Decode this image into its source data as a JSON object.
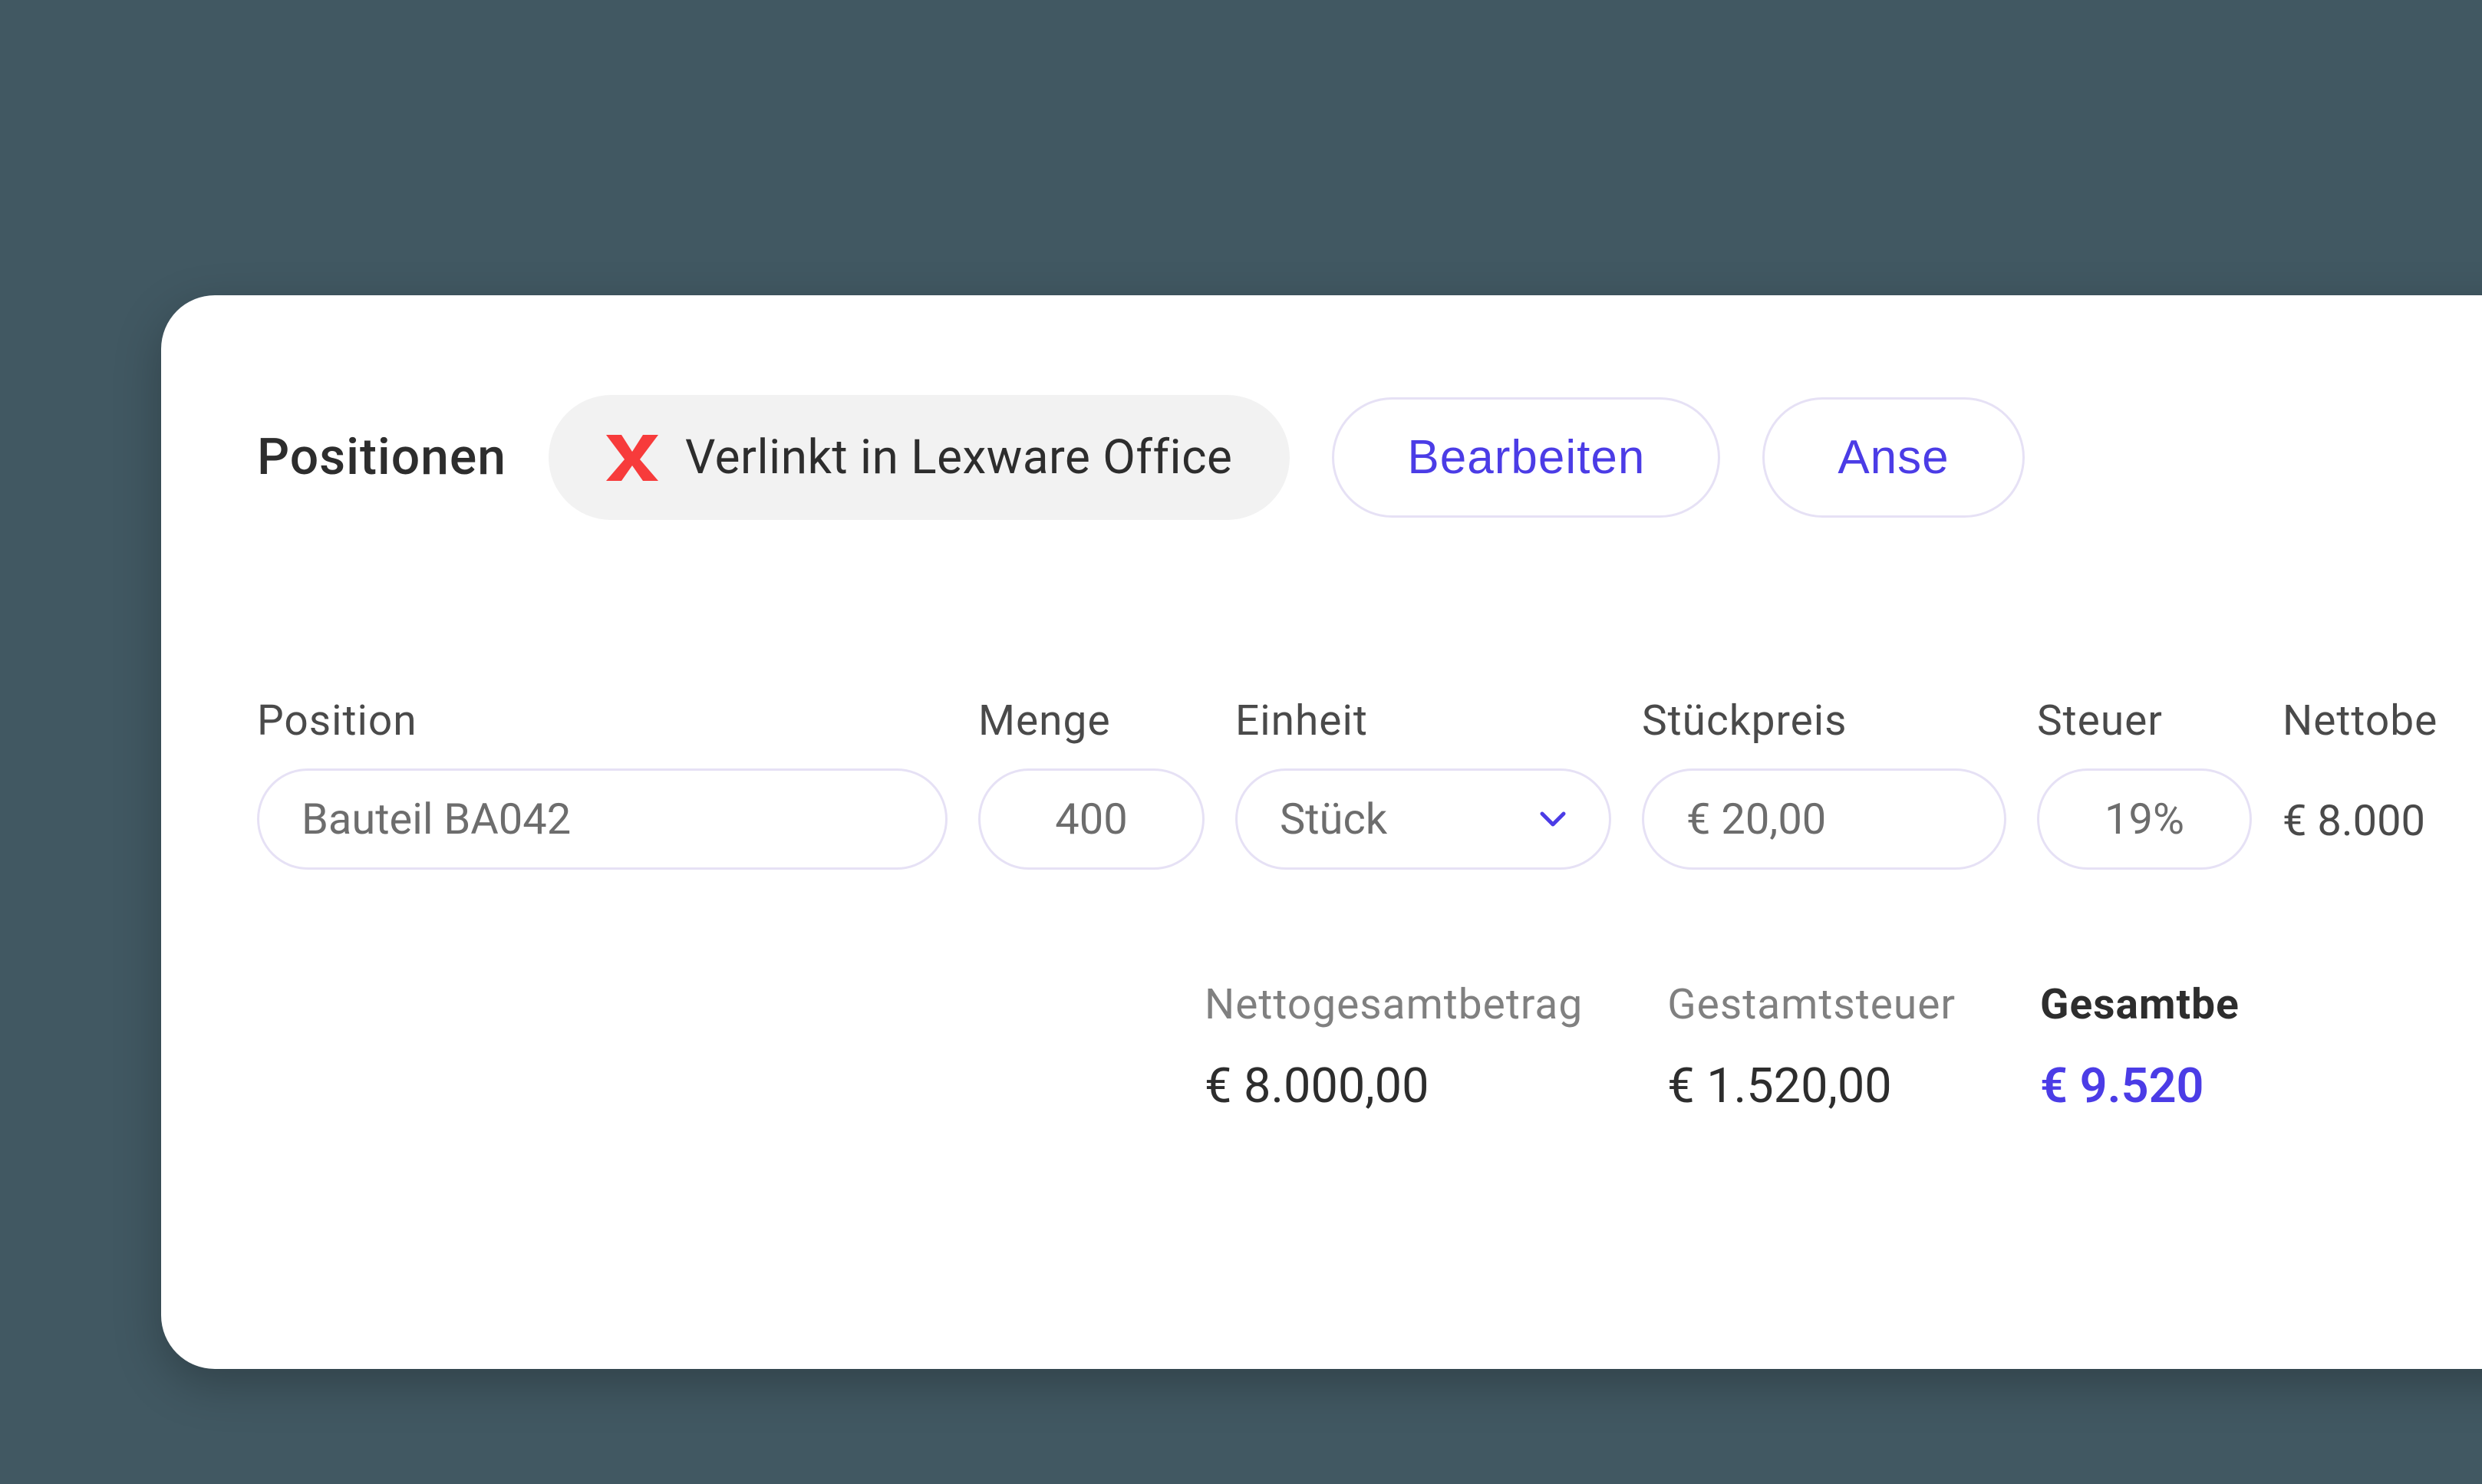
{
  "header": {
    "section_title": "Positionen",
    "linked_text": "Verlinkt in Lexware Office",
    "edit_button": "Bearbeiten",
    "view_button": "Anse"
  },
  "columns": {
    "position": {
      "label": "Position",
      "value": "Bauteil BA042"
    },
    "menge": {
      "label": "Menge",
      "value": "400"
    },
    "einheit": {
      "label": "Einheit",
      "value": "Stück"
    },
    "stueckpreis": {
      "label": "Stückpreis",
      "value": "€ 20,00"
    },
    "steuer": {
      "label": "Steuer",
      "value": "19%"
    },
    "netto": {
      "label": "Nettobe",
      "value": "€ 8.000"
    }
  },
  "totals": {
    "netto": {
      "label": "Nettogesamtbetrag",
      "value": "€ 8.000,00"
    },
    "steuer": {
      "label": "Gestamtsteuer",
      "value": "€ 1.520,00"
    },
    "gesamt": {
      "label": "Gesamtbe",
      "value": "€ 9.520"
    }
  },
  "colors": {
    "accent": "#4b3ce6",
    "logo": "#f73b3b"
  }
}
